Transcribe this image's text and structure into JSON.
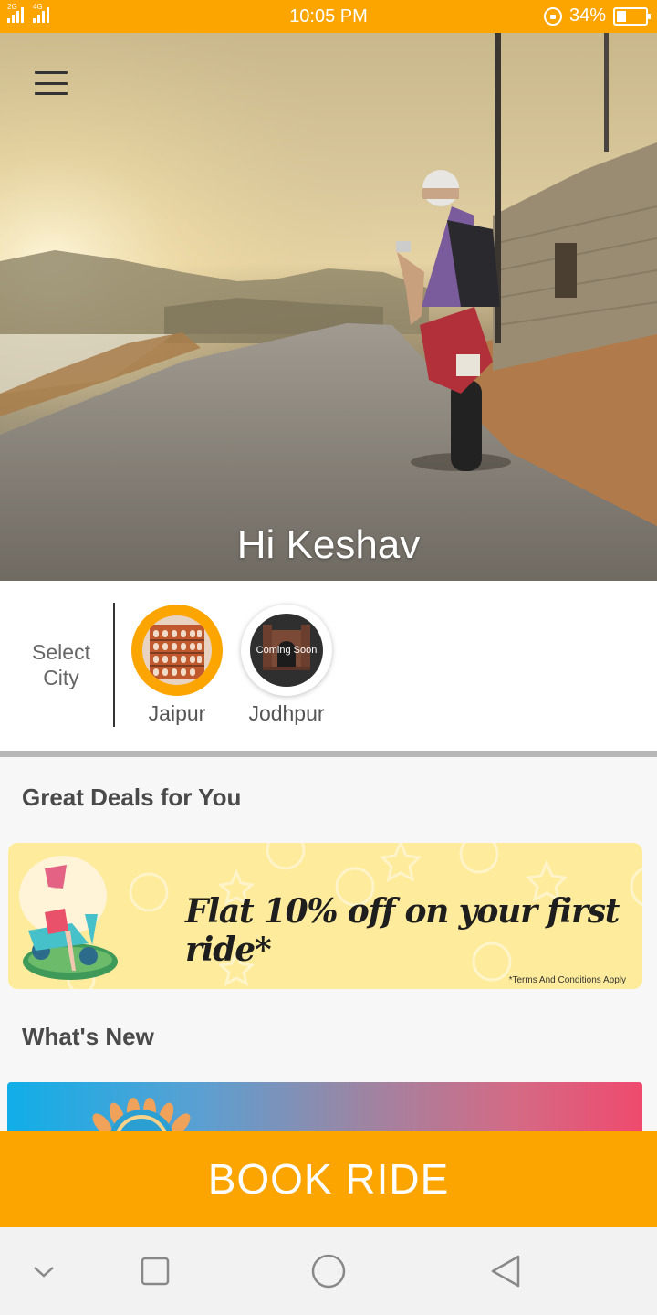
{
  "status_bar": {
    "network_1": "2G",
    "network_2": "4G",
    "time": "10:05 PM",
    "battery_percent": "34%",
    "battery_level": 0.34
  },
  "hero": {
    "menu_icon": "hamburger-menu-icon",
    "greeting": "Hi Keshav"
  },
  "city_selector": {
    "label": "Select City",
    "cities": [
      {
        "name": "Jaipur",
        "selected": true,
        "badge": ""
      },
      {
        "name": "Jodhpur",
        "selected": false,
        "badge": "Coming Soon"
      }
    ]
  },
  "deals": {
    "title": "Great Deals for You",
    "offer_text": "Flat 10% off on your first ride*",
    "terms": "*Terms And Conditions Apply"
  },
  "whats_new": {
    "title": "What's New"
  },
  "book_ride": {
    "label": "BOOK RIDE"
  },
  "nav_bar": {
    "icons": [
      "chevron-down-icon",
      "recents-square-icon",
      "home-circle-icon",
      "back-triangle-icon"
    ]
  },
  "colors": {
    "accent": "#fca500",
    "deal_background": "#feeb9b"
  }
}
